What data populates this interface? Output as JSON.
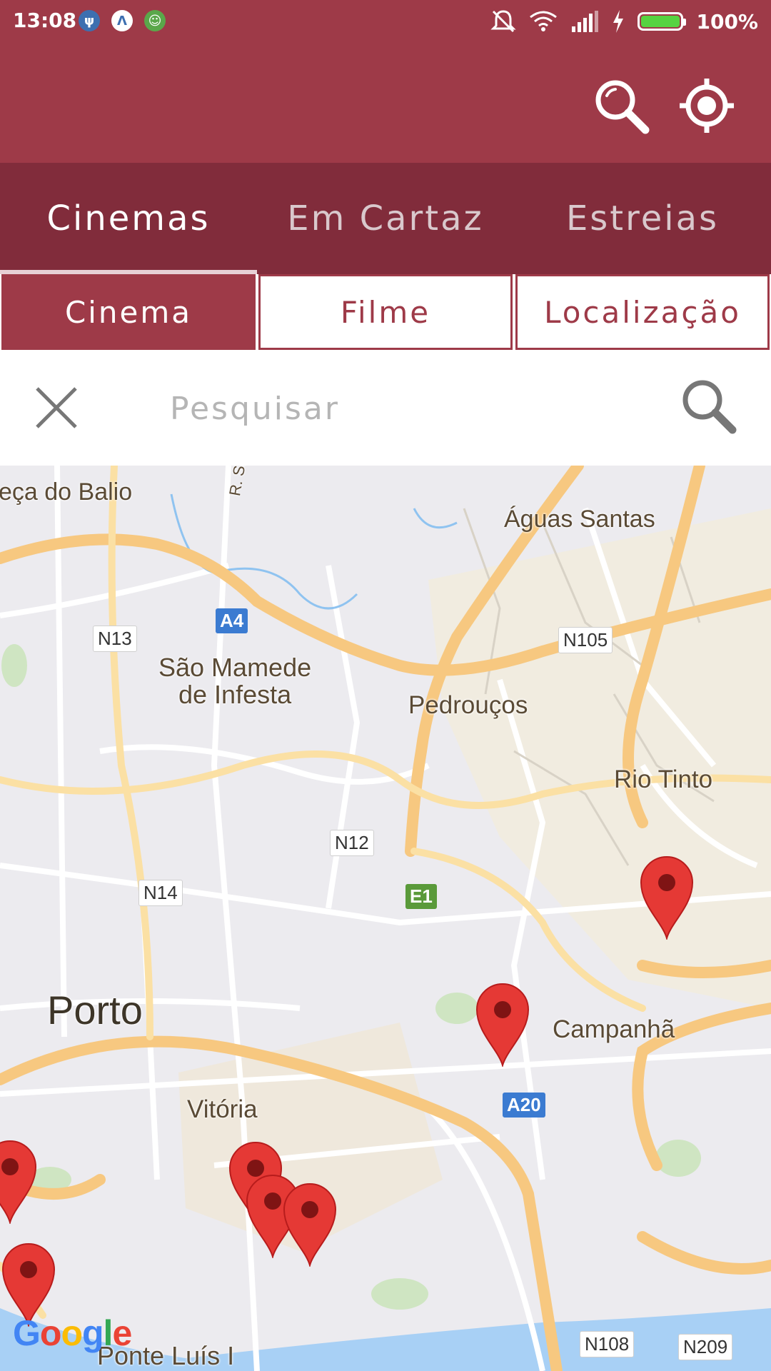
{
  "status_bar": {
    "time": "13:08",
    "battery_percent": "100%",
    "battery_level": 1.0,
    "icons": [
      "usb-icon",
      "accessibility-icon",
      "android-debug-icon",
      "mute-icon",
      "wifi-icon",
      "signal-icon",
      "charging-icon",
      "battery-icon"
    ]
  },
  "appbar": {
    "actions": [
      "search-icon",
      "my-location-icon"
    ]
  },
  "tabs": [
    {
      "label": "Cinemas",
      "active": true
    },
    {
      "label": "Em Cartaz",
      "active": false
    },
    {
      "label": "Estreias",
      "active": false
    }
  ],
  "filters": [
    {
      "label": "Cinema",
      "active": true
    },
    {
      "label": "Filme",
      "active": false
    },
    {
      "label": "Localização",
      "active": false
    }
  ],
  "search": {
    "placeholder": "Pesquisar",
    "value": ""
  },
  "map": {
    "places": [
      {
        "name": "eça do Balio"
      },
      {
        "name": "R. Santana"
      },
      {
        "name": "Águas Santas"
      },
      {
        "name": "São Mamede"
      },
      {
        "name": "de Infesta"
      },
      {
        "name": "Pedrouços"
      },
      {
        "name": "Rio Tinto"
      },
      {
        "name": "Porto"
      },
      {
        "name": "Campanhã"
      },
      {
        "name": "Vitória"
      },
      {
        "name": "Ponte Luís I"
      }
    ],
    "roads": [
      "A4",
      "N13",
      "N105",
      "N12",
      "N14",
      "E1",
      "A20",
      "N108",
      "N209"
    ],
    "attribution": "Google",
    "marker_count": 8
  }
}
